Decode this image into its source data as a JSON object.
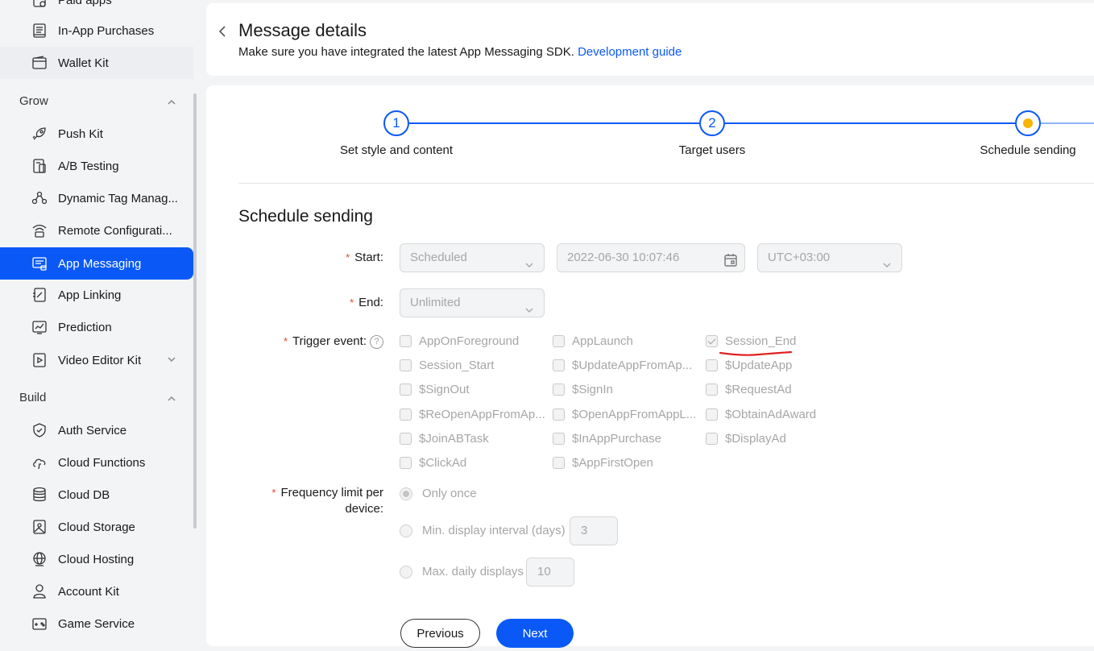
{
  "sidebar": {
    "top_items": [
      {
        "label": "Paid apps",
        "icon": "paid-apps-icon"
      },
      {
        "label": "In-App Purchases",
        "icon": "receipt-icon"
      },
      {
        "label": "Wallet Kit",
        "icon": "wallet-icon"
      }
    ],
    "groups": [
      {
        "title": "Grow",
        "items": [
          {
            "label": "Push Kit",
            "icon": "rocket-icon"
          },
          {
            "label": "A/B Testing",
            "icon": "ab-test-icon"
          },
          {
            "label": "Dynamic Tag Manag...",
            "icon": "tag-nodes-icon"
          },
          {
            "label": "Remote Configurati...",
            "icon": "wifi-config-icon"
          },
          {
            "label": "App Messaging",
            "icon": "message-icon"
          },
          {
            "label": "App Linking",
            "icon": "link-doc-icon"
          },
          {
            "label": "Prediction",
            "icon": "chart-icon"
          },
          {
            "label": "Video Editor Kit",
            "icon": "video-icon"
          }
        ]
      },
      {
        "title": "Build",
        "items": [
          {
            "label": "Auth Service",
            "icon": "shield-icon"
          },
          {
            "label": "Cloud Functions",
            "icon": "cloud-functions-icon"
          },
          {
            "label": "Cloud DB",
            "icon": "database-icon"
          },
          {
            "label": "Cloud Storage",
            "icon": "storage-icon"
          },
          {
            "label": "Cloud Hosting",
            "icon": "globe-icon"
          },
          {
            "label": "Account Kit",
            "icon": "user-icon"
          },
          {
            "label": "Game Service",
            "icon": "gamepad-icon"
          }
        ]
      }
    ],
    "active_item": "App Messaging"
  },
  "header": {
    "title": "Message details",
    "description": "Make sure you have integrated the latest App Messaging SDK.",
    "link_text": "Development guide"
  },
  "steps": [
    {
      "number": "1",
      "label": "Set style and content"
    },
    {
      "number": "2",
      "label": "Target users"
    },
    {
      "number": "",
      "label": "Schedule sending"
    }
  ],
  "form": {
    "section_title": "Schedule sending",
    "start": {
      "label": "Start:",
      "mode": "Scheduled",
      "datetime": "2022-06-30 10:07:46",
      "timezone": "UTC+03:00"
    },
    "end": {
      "label": "End:",
      "value": "Unlimited"
    },
    "trigger": {
      "label": "Trigger event:",
      "help": "?",
      "events": [
        {
          "name": "AppOnForeground",
          "checked": false
        },
        {
          "name": "AppLaunch",
          "checked": false
        },
        {
          "name": "Session_End",
          "checked": true
        },
        {
          "name": "Session_Start",
          "checked": false
        },
        {
          "name": "$UpdateAppFromAp...",
          "checked": false
        },
        {
          "name": "$UpdateApp",
          "checked": false
        },
        {
          "name": "$SignOut",
          "checked": false
        },
        {
          "name": "$SignIn",
          "checked": false
        },
        {
          "name": "$RequestAd",
          "checked": false
        },
        {
          "name": "$ReOpenAppFromAp...",
          "checked": false
        },
        {
          "name": "$OpenAppFromAppL...",
          "checked": false
        },
        {
          "name": "$ObtainAdAward",
          "checked": false
        },
        {
          "name": "$JoinABTask",
          "checked": false
        },
        {
          "name": "$InAppPurchase",
          "checked": false
        },
        {
          "name": "$DisplayAd",
          "checked": false
        },
        {
          "name": "$ClickAd",
          "checked": false
        },
        {
          "name": "$AppFirstOpen",
          "checked": false
        }
      ]
    },
    "frequency": {
      "label_line1": "Frequency limit per",
      "label_line2": "device:",
      "options": [
        {
          "label": "Only once",
          "selected": true
        },
        {
          "label": "Min. display interval (days)",
          "selected": false,
          "value": "3"
        },
        {
          "label": "Max. daily displays",
          "selected": false,
          "value": "10"
        }
      ]
    }
  },
  "buttons": {
    "previous": "Previous",
    "next": "Next"
  },
  "colors": {
    "accent": "#0a59f7",
    "current_step": "#f7b500",
    "annotation": "#e02020"
  }
}
